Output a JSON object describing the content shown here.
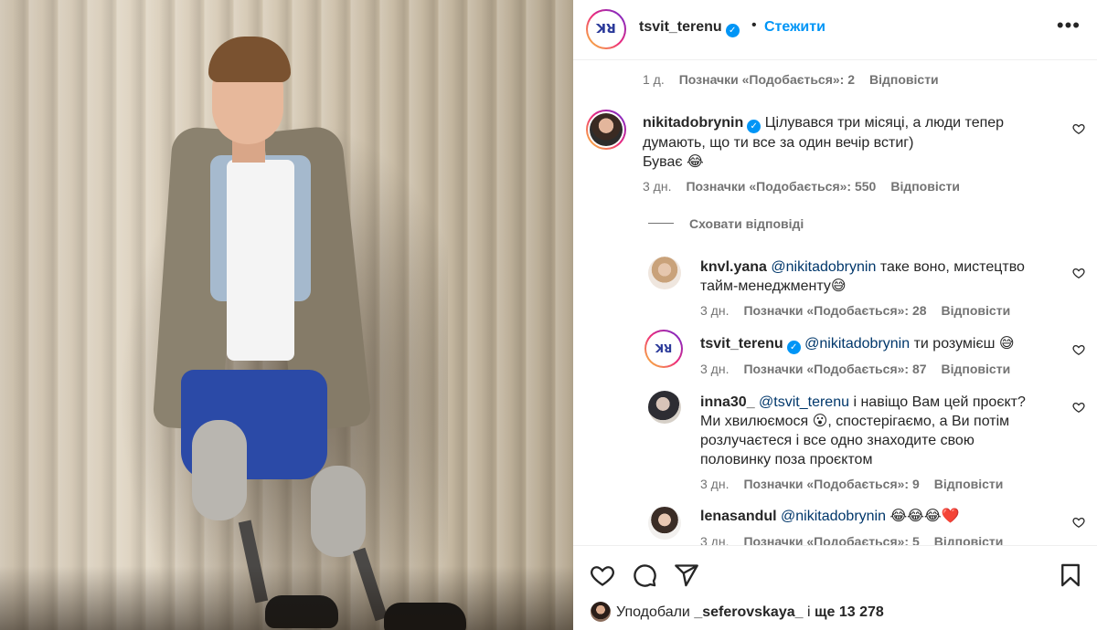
{
  "header": {
    "username": "tsvit_terenu",
    "separator": "•",
    "follow_label": "Стежити",
    "more_label": "•••"
  },
  "comments": {
    "top_meta": {
      "time": "1 д.",
      "likes": "Позначки «Подобається»: 2",
      "reply": "Відповісти"
    },
    "main": {
      "user": "nikitadobrynin",
      "text_line1": "Цілувався три місяці, а люди тепер",
      "text_line2": "думають, що ти все за один вечір встиг)",
      "text_line3": "Буває 😂",
      "time": "3 дн.",
      "likes": "Позначки «Подобається»: 550",
      "reply": "Відповісти"
    },
    "hide_replies": "Сховати відповіді",
    "replies": [
      {
        "user": "knvl.yana",
        "mention": "@nikitadobrynin",
        "text_a": "таке воно, мистецтво",
        "text_b": "тайм-менеджменту😅",
        "time": "3 дн.",
        "likes": "Позначки «Подобається»: 28",
        "reply": "Відповісти"
      },
      {
        "user": "tsvit_terenu",
        "mention": "@nikitadobrynin",
        "text_a": "ти розумієш 😅",
        "time": "3 дн.",
        "likes": "Позначки «Подобається»: 87",
        "reply": "Відповісти"
      },
      {
        "user": "inna30_",
        "mention": "@tsvit_terenu",
        "text_a": "і навіщо Вам цей проєкт?",
        "text_b": "Ми хвилюємося 😮, спостерігаємо, а Ви потім",
        "text_c": "розлучаєтеся і все одно знаходите свою",
        "text_d": "половинку поза проєктом",
        "time": "3 дн.",
        "likes": "Позначки «Подобається»: 9",
        "reply": "Відповісти"
      },
      {
        "user": "lenasandul",
        "mention": "@nikitadobrynin",
        "text_a": "😂😂😂❤️",
        "time": "3 дн.",
        "likes": "Позначки «Подобається»: 5",
        "reply": "Відповісти"
      }
    ]
  },
  "footer": {
    "liked_by_prefix": "Уподобали",
    "liked_by_user": "_seferovskaya_",
    "liked_by_suffix": "і",
    "liked_by_count": "ще 13 278"
  },
  "icons": [
    "heart-icon",
    "comment-icon",
    "share-icon",
    "bookmark-icon",
    "more-icon",
    "verified-icon"
  ],
  "colors": {
    "accent": "#0095f6",
    "mention": "#00376b",
    "meta": "#737373",
    "text": "#262626"
  }
}
